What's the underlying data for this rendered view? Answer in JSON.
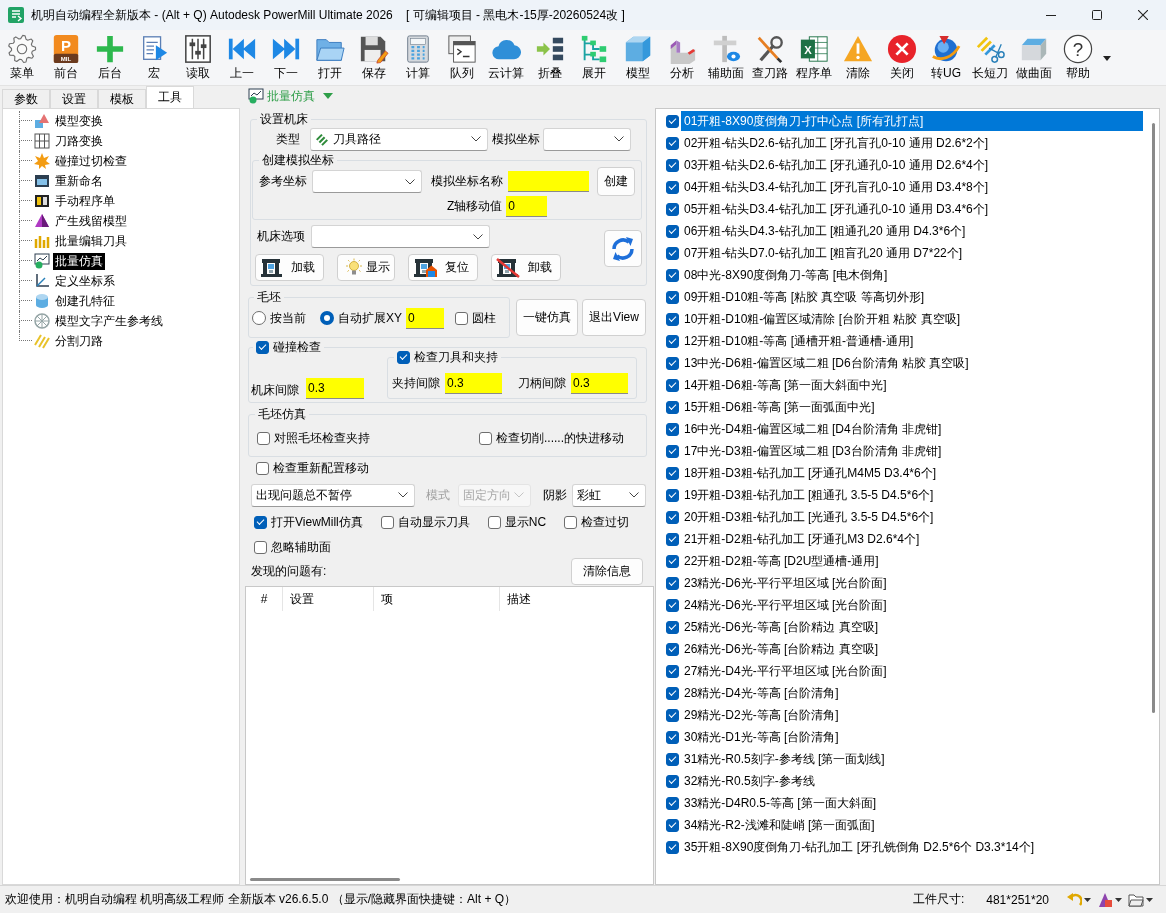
{
  "window": {
    "title": "机明自动编程全新版本 - (Alt + Q) Autodesk PowerMill Ultimate 2026    [ 可编辑项目 - 黑电木-15厚-20260524改 ]"
  },
  "toolbar": [
    {
      "label": "菜单"
    },
    {
      "label": "前台",
      "icon_text": "P",
      "icon_caption": "MIL"
    },
    {
      "label": "后台"
    },
    {
      "label": "宏"
    },
    {
      "label": "读取"
    },
    {
      "label": "上一"
    },
    {
      "label": "下一"
    },
    {
      "label": "打开"
    },
    {
      "label": "保存"
    },
    {
      "label": "计算"
    },
    {
      "label": "队列"
    },
    {
      "label": "云计算"
    },
    {
      "label": "折叠"
    },
    {
      "label": "展开"
    },
    {
      "label": "模型"
    },
    {
      "label": "分析"
    },
    {
      "label": "辅助面"
    },
    {
      "label": "查刀路"
    },
    {
      "label": "程序单",
      "icon_text": "X"
    },
    {
      "label": "清除"
    },
    {
      "label": "关闭"
    },
    {
      "label": "转UG"
    },
    {
      "label": "长短刀"
    },
    {
      "label": "做曲面"
    },
    {
      "label": "帮助",
      "icon_text": "?"
    }
  ],
  "left_panel": {
    "tabs": [
      {
        "label": "参数",
        "selected": false
      },
      {
        "label": "设置",
        "selected": false
      },
      {
        "label": "模板",
        "selected": false
      },
      {
        "label": "工具",
        "selected": true
      }
    ],
    "tools": [
      {
        "label": "模型变换",
        "selected": false
      },
      {
        "label": "刀路变换",
        "selected": false
      },
      {
        "label": "碰撞过切检查",
        "selected": false
      },
      {
        "label": "重新命名",
        "selected": false
      },
      {
        "label": "手动程序单",
        "selected": false
      },
      {
        "label": "产生残留模型",
        "selected": false
      },
      {
        "label": "批量编辑刀具",
        "selected": false
      },
      {
        "label": "批量仿真",
        "selected": true
      },
      {
        "label": "定义坐标系",
        "selected": false
      },
      {
        "label": "创建孔特征",
        "selected": false
      },
      {
        "label": "模型文字产生参考线",
        "selected": false
      },
      {
        "label": "分割刀路",
        "selected": false
      }
    ]
  },
  "batch_simulation": {
    "title": "批量仿真",
    "machine": {
      "legend": "设置机床",
      "type_label": "类型",
      "type_value": "刀具路径",
      "sim_coord_label": "模拟坐标",
      "create": {
        "legend": "创建模拟坐标",
        "ref_label": "参考坐标",
        "name_label": "模拟坐标名称",
        "button": "创建",
        "z_label": "Z轴移动值",
        "z_value": "0"
      },
      "options_label": "机床选项",
      "buttons": [
        "加载",
        "显示",
        "复位",
        "卸载"
      ]
    },
    "stock": {
      "legend": "毛坯",
      "options": [
        {
          "label": "按当前",
          "selected": false
        },
        {
          "label": "自动扩展XY",
          "selected": true
        }
      ],
      "expand_value": "0",
      "cylinder": {
        "label": "圆柱",
        "checked": false
      }
    },
    "action_buttons": [
      "一键仿真",
      "退出View"
    ],
    "collision": {
      "label": "碰撞检查",
      "checked": true,
      "machine_gap_label": "机床间隙",
      "machine_gap_value": "0.3",
      "holder": {
        "label": "检查刀具和夹持",
        "checked": true,
        "fields": [
          {
            "label": "夹持间隙",
            "value": "0.3"
          },
          {
            "label": "刀柄间隙",
            "value": "0.3"
          }
        ]
      }
    },
    "stock_sim": {
      "legend": "毛坯仿真",
      "options": [
        {
          "label": "对照毛坯检查夹持",
          "checked": false
        },
        {
          "label": "检查切削......的快进移动",
          "checked": false
        }
      ]
    },
    "reconfig": {
      "label": "检查重新配置移动",
      "checked": false
    },
    "pause_value": "出现问题总不暂停",
    "mode": {
      "label": "模式",
      "value": "固定方向",
      "disabled": true
    },
    "shade": {
      "label": "阴影",
      "value": "彩虹"
    },
    "view_options": [
      {
        "label": "打开ViewMill仿真",
        "checked": true
      },
      {
        "label": "自动显示刀具",
        "checked": false
      },
      {
        "label": "显示NC",
        "checked": false
      },
      {
        "label": "检查过切",
        "checked": false
      }
    ],
    "ignore_option": {
      "label": "忽略辅助面",
      "checked": false
    },
    "problems_label": "发现的问题有:",
    "clear_button": "清除信息",
    "table": {
      "columns": [
        "#",
        "设置",
        "项",
        "描述"
      ]
    }
  },
  "toolpath_list": [
    {
      "label": "01开粗-8X90度倒角刀-打中心点 [所有孔打点]",
      "checked": true,
      "selected": true
    },
    {
      "label": "02开粗-钻头D2.6-钻孔加工 [牙孔盲孔0-10 通用 D2.6*2个]",
      "checked": true,
      "selected": false
    },
    {
      "label": "03开粗-钻头D2.6-钻孔加工 [牙孔通孔0-10 通用 D2.6*4个]",
      "checked": true,
      "selected": false
    },
    {
      "label": "04开粗-钻头D3.4-钻孔加工 [牙孔盲孔0-10 通用 D3.4*8个]",
      "checked": true,
      "selected": false
    },
    {
      "label": "05开粗-钻头D3.4-钻孔加工 [牙孔通孔0-10 通用 D3.4*6个]",
      "checked": true,
      "selected": false
    },
    {
      "label": "06开粗-钻头D4.3-钻孔加工 [粗通孔20 通用 D4.3*6个]",
      "checked": true,
      "selected": false
    },
    {
      "label": "07开粗-钻头D7.0-钻孔加工 [粗盲孔20 通用 D7*22个]",
      "checked": true,
      "selected": false
    },
    {
      "label": "08中光-8X90度倒角刀-等高 [电木倒角]",
      "checked": true,
      "selected": false
    },
    {
      "label": "09开粗-D10粗-等高 [粘胶 真空吸 等高切外形]",
      "checked": true,
      "selected": false
    },
    {
      "label": "10开粗-D10粗-偏置区域清除 [台阶开粗 粘胶 真空吸]",
      "checked": true,
      "selected": false
    },
    {
      "label": "12开粗-D10粗-等高 [通槽开粗-普通槽-通用]",
      "checked": true,
      "selected": false
    },
    {
      "label": "13中光-D6粗-偏置区域二粗 [D6台阶清角 粘胶 真空吸]",
      "checked": true,
      "selected": false
    },
    {
      "label": "14开粗-D6粗-等高 [第一面大斜面中光]",
      "checked": true,
      "selected": false
    },
    {
      "label": "15开粗-D6粗-等高 [第一面弧面中光]",
      "checked": true,
      "selected": false
    },
    {
      "label": "16中光-D4粗-偏置区域二粗 [D4台阶清角 非虎钳]",
      "checked": true,
      "selected": false
    },
    {
      "label": "17中光-D3粗-偏置区域二粗 [D3台阶清角 非虎钳]",
      "checked": true,
      "selected": false
    },
    {
      "label": "18开粗-D3粗-钻孔加工 [牙通孔M4M5 D3.4*6个]",
      "checked": true,
      "selected": false
    },
    {
      "label": "19开粗-D3粗-钻孔加工 [粗通孔 3.5-5 D4.5*6个]",
      "checked": true,
      "selected": false
    },
    {
      "label": "20开粗-D3粗-钻孔加工 [光通孔 3.5-5 D4.5*6个]",
      "checked": true,
      "selected": false
    },
    {
      "label": "21开粗-D2粗-钻孔加工 [牙通孔M3 D2.6*4个]",
      "checked": true,
      "selected": false
    },
    {
      "label": "22开粗-D2粗-等高 [D2U型通槽-通用]",
      "checked": true,
      "selected": false
    },
    {
      "label": "23精光-D6光-平行平坦区域 [光台阶面]",
      "checked": true,
      "selected": false
    },
    {
      "label": "24精光-D6光-平行平坦区域 [光台阶面]",
      "checked": true,
      "selected": false
    },
    {
      "label": "25精光-D6光-等高 [台阶精边 真空吸]",
      "checked": true,
      "selected": false
    },
    {
      "label": "26精光-D6光-等高 [台阶精边 真空吸]",
      "checked": true,
      "selected": false
    },
    {
      "label": "27精光-D4光-平行平坦区域 [光台阶面]",
      "checked": true,
      "selected": false
    },
    {
      "label": "28精光-D4光-等高 [台阶清角]",
      "checked": true,
      "selected": false
    },
    {
      "label": "29精光-D2光-等高 [台阶清角]",
      "checked": true,
      "selected": false
    },
    {
      "label": "30精光-D1光-等高 [台阶清角]",
      "checked": true,
      "selected": false
    },
    {
      "label": "31精光-R0.5刻字-参考线 [第一面划线]",
      "checked": true,
      "selected": false
    },
    {
      "label": "32精光-R0.5刻字-参考线",
      "checked": true,
      "selected": false
    },
    {
      "label": "33精光-D4R0.5-等高 [第一面大斜面]",
      "checked": true,
      "selected": false
    },
    {
      "label": "34精光-R2-浅滩和陡峭 [第一面弧面]",
      "checked": true,
      "selected": false
    },
    {
      "label": "35开粗-8X90度倒角刀-钻孔加工 [牙孔铣倒角 D2.5*6个 D3.3*14个]",
      "checked": true,
      "selected": false
    }
  ],
  "status_bar": {
    "message": "欢迎使用：机明自动编程 机明高级工程师 全新版本 v26.6.5.0 （显示/隐藏界面快捷键：Alt + Q）",
    "size_label": "工件尺寸:",
    "size_value": "481*251*20"
  }
}
